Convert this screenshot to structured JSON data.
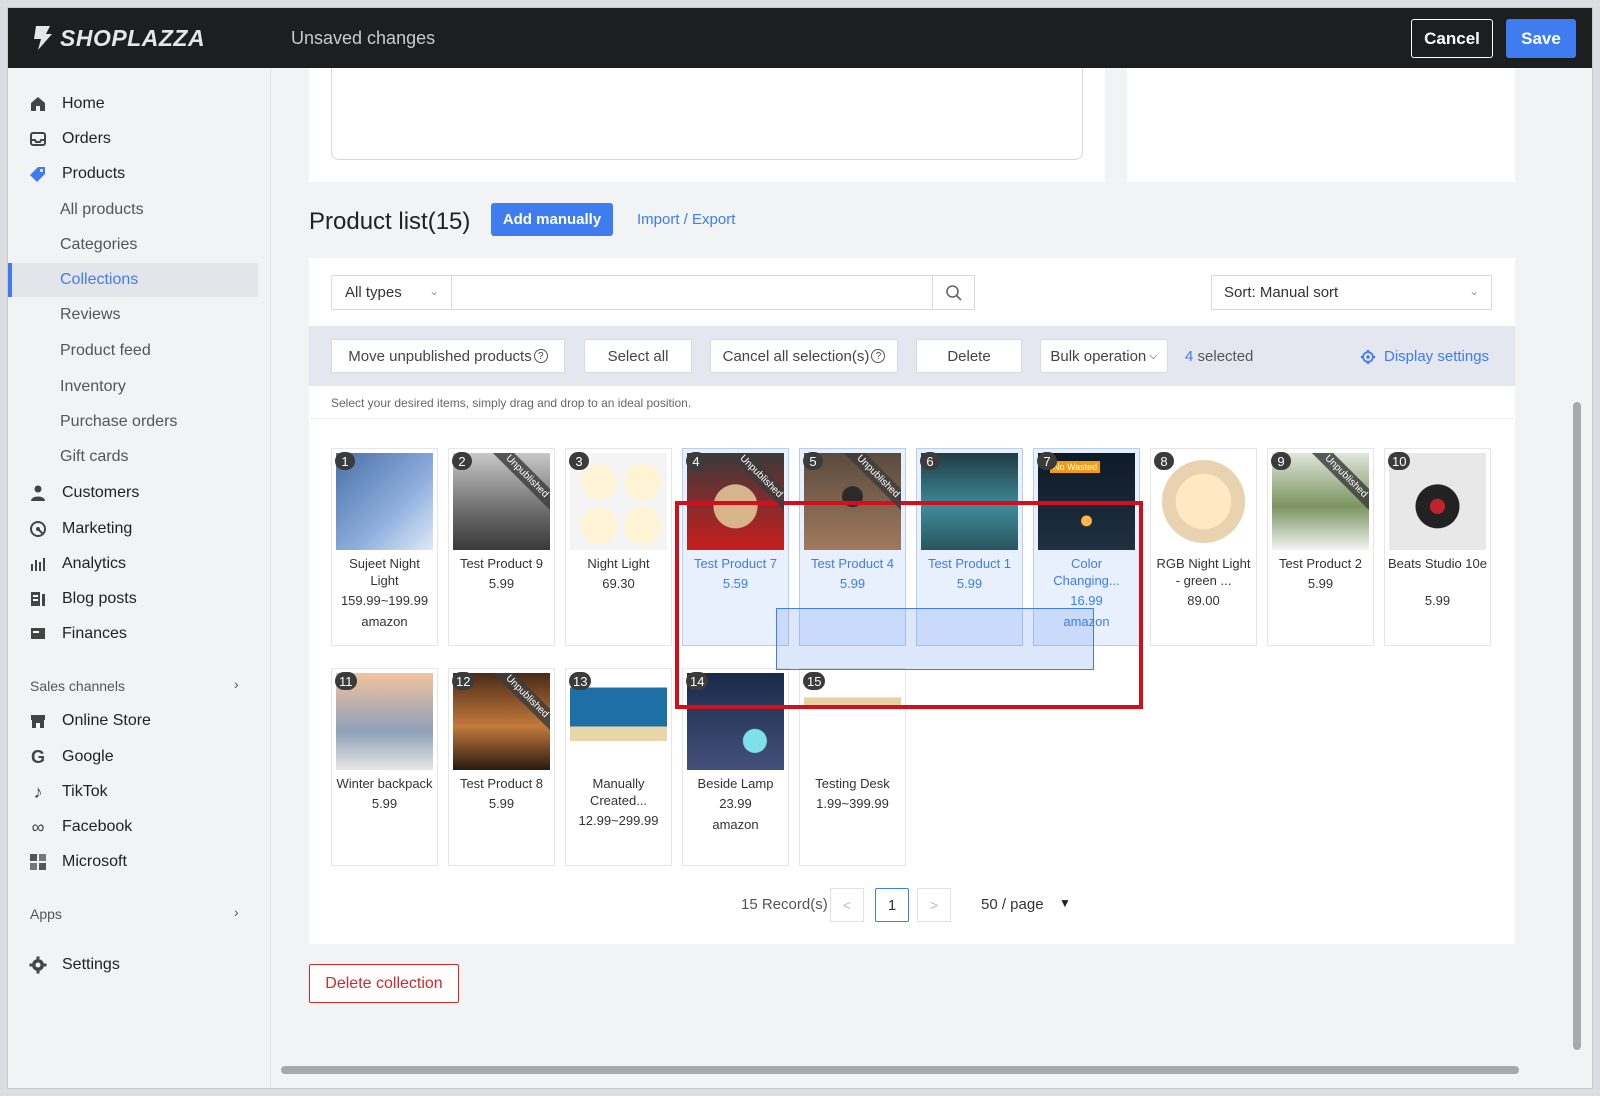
{
  "topbar": {
    "brand": "SHOPLAZZA",
    "status": "Unsaved changes",
    "cancel_label": "Cancel",
    "save_label": "Save"
  },
  "sidebar": {
    "items": [
      {
        "label": "Home",
        "icon": "home-icon"
      },
      {
        "label": "Orders",
        "icon": "inbox-icon"
      },
      {
        "label": "Products",
        "icon": "tag-icon"
      }
    ],
    "product_subitems": [
      "All products",
      "Categories",
      "Collections",
      "Reviews",
      "Product feed",
      "Inventory",
      "Purchase orders",
      "Gift cards"
    ],
    "active_subitem": "Collections",
    "more_items": [
      {
        "label": "Customers",
        "icon": "user-icon"
      },
      {
        "label": "Marketing",
        "icon": "marketing-icon"
      },
      {
        "label": "Analytics",
        "icon": "bar-chart-icon"
      },
      {
        "label": "Blog posts",
        "icon": "blog-icon"
      },
      {
        "label": "Finances",
        "icon": "finance-icon"
      }
    ],
    "sales_channels_label": "Sales channels",
    "channels": [
      {
        "label": "Online Store",
        "icon": "store-icon"
      },
      {
        "label": "Google",
        "icon": "google-icon"
      },
      {
        "label": "TikTok",
        "icon": "tiktok-icon"
      },
      {
        "label": "Facebook",
        "icon": "meta-icon"
      },
      {
        "label": "Microsoft",
        "icon": "microsoft-icon"
      }
    ],
    "apps_label": "Apps",
    "settings_label": "Settings"
  },
  "product_list": {
    "title": "Product list(15)",
    "add_manually": "Add manually",
    "import_export": "Import / Export",
    "type_filter": "All types",
    "search_placeholder": "",
    "sort": "Sort: Manual sort",
    "toolbar": {
      "move_unpublished": "Move unpublished products",
      "select_all": "Select all",
      "cancel_all": "Cancel all selection(s)",
      "delete": "Delete",
      "bulk_operation": "Bulk operation",
      "selected_count": "4",
      "selected_suffix": "selected",
      "display_settings": "Display settings"
    },
    "hint": "Select your desired items, simply drag and drop to an ideal position.",
    "unpublished_label": "Unpublished",
    "products": [
      {
        "n": "1",
        "name": "Sujeet Night Light",
        "price": "159.99~199.99",
        "vendor": "amazon",
        "unpublished": false,
        "selected": false
      },
      {
        "n": "2",
        "name": "Test Product 9",
        "price": "5.99",
        "vendor": "",
        "unpublished": true,
        "selected": false
      },
      {
        "n": "3",
        "name": "Night Light",
        "price": "69.30",
        "vendor": "",
        "unpublished": false,
        "selected": false
      },
      {
        "n": "4",
        "name": "Test Product 7",
        "price": "5.59",
        "vendor": "",
        "unpublished": true,
        "selected": true
      },
      {
        "n": "5",
        "name": "Test Product 4",
        "price": "5.99",
        "vendor": "",
        "unpublished": true,
        "selected": true
      },
      {
        "n": "6",
        "name": "Test Product 1",
        "price": "5.99",
        "vendor": "",
        "unpublished": false,
        "selected": true
      },
      {
        "n": "7",
        "name": "Color Changing...",
        "price": "16.99",
        "vendor": "amazon",
        "unpublished": false,
        "selected": true
      },
      {
        "n": "8",
        "name": "RGB Night Light - green ...",
        "price": "89.00",
        "vendor": "",
        "unpublished": false,
        "selected": false
      },
      {
        "n": "9",
        "name": "Test Product 2",
        "price": "5.99",
        "vendor": "",
        "unpublished": true,
        "selected": false
      },
      {
        "n": "10",
        "name": "Beats Studio 10e",
        "price": "5.99",
        "vendor": "",
        "unpublished": false,
        "selected": false
      },
      {
        "n": "11",
        "name": "Winter backpack",
        "price": "5.99",
        "vendor": "",
        "unpublished": false,
        "selected": false
      },
      {
        "n": "12",
        "name": "Test Product 8",
        "price": "5.99",
        "vendor": "",
        "unpublished": true,
        "selected": false
      },
      {
        "n": "13",
        "name": "Manually Created...",
        "price": "12.99~299.99",
        "vendor": "",
        "unpublished": false,
        "selected": false
      },
      {
        "n": "14",
        "name": "Beside Lamp",
        "price": "23.99",
        "vendor": "amazon",
        "unpublished": false,
        "selected": false
      },
      {
        "n": "15",
        "name": "Testing Desk",
        "price": "1.99~399.99",
        "vendor": "",
        "unpublished": false,
        "selected": false
      }
    ],
    "pager": {
      "records": "15 Record(s)",
      "current_page": "1",
      "page_size": "50 / page"
    },
    "delete_collection": "Delete collection",
    "badge_text_7": "No Wasted"
  },
  "colors": {
    "accent": "#3e7cf0",
    "danger": "#d12a2a",
    "topbar": "#1d1e20",
    "highlight_box": "#d40f1d"
  }
}
